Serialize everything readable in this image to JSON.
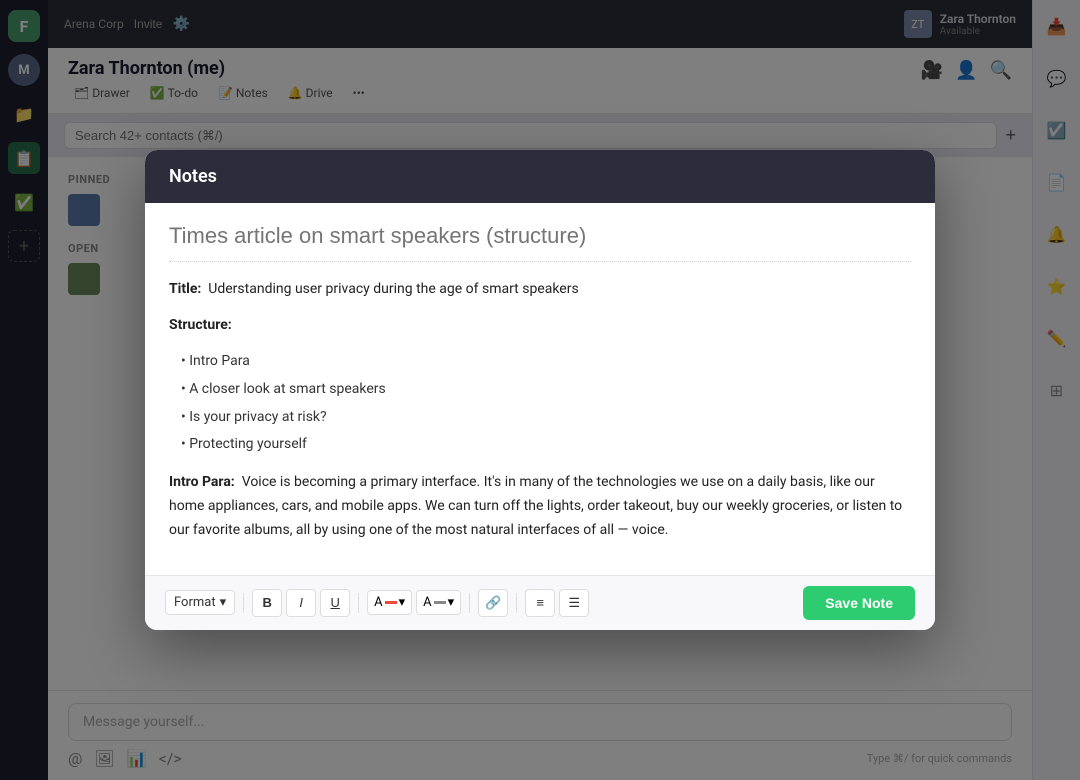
{
  "app": {
    "logo_letter": "F",
    "workspace": "Arena Corp",
    "invite_label": "Invite"
  },
  "sidebar": {
    "avatar_letter": "M",
    "icons": [
      "📁",
      "📋",
      "✅"
    ]
  },
  "header": {
    "user_name": "Zara Thornton",
    "user_status": "Available",
    "chat_title": "Zara Thornton (me)",
    "action_buttons": [
      "Drawer",
      "To-do",
      "Notes",
      "Drive"
    ]
  },
  "search": {
    "placeholder": "Search 42+ contacts (⌘/)"
  },
  "sections": {
    "pinned_label": "PINNED",
    "open_label": "OPEN"
  },
  "chat": {
    "input_placeholder": "Message yourself...",
    "quick_commands": "Type ⌘/ for quick commands"
  },
  "modal": {
    "title": "Notes",
    "note_title_placeholder": "Times article on smart speakers (structure)",
    "content": {
      "title_label": "Title:",
      "title_text": "Uderstanding user privacy during the age of smart speakers",
      "structure_label": "Structure:",
      "bullets": [
        "Intro Para",
        "A closer look at smart speakers",
        "Is your privacy at risk?",
        "Protecting yourself"
      ],
      "intro_label": "Intro Para:",
      "intro_text": "Voice is becoming a primary interface. It's in many of the technologies we use on a daily basis, like our home appliances, cars, and mobile apps. We can turn off the lights, order takeout, buy our weekly groceries, or listen to our favorite albums, all by using one of the most natural interfaces of all — voice."
    },
    "toolbar": {
      "format_label": "Format",
      "bold_label": "B",
      "italic_label": "I",
      "underline_label": "U",
      "save_label": "Save Note"
    }
  }
}
